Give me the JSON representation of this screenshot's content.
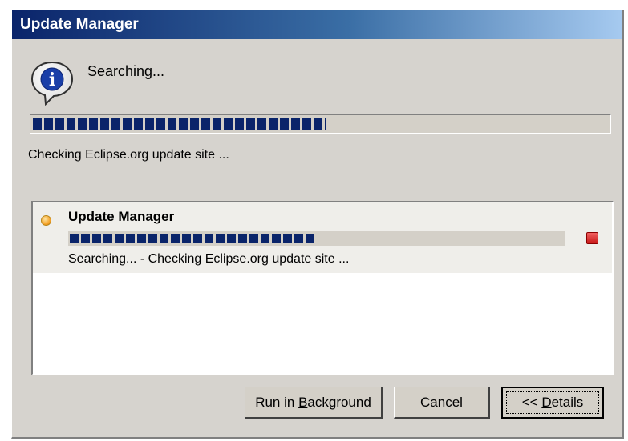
{
  "window": {
    "title": "Update Manager"
  },
  "status": {
    "message": "Searching...",
    "progress": 0.51,
    "detail": "Checking Eclipse.org update site ..."
  },
  "details": {
    "job": {
      "title": "Update Manager",
      "progress": 0.5,
      "detail": "Searching... - Checking Eclipse.org update site ..."
    }
  },
  "buttons": {
    "run_in_background": {
      "prefix": "Run in ",
      "accel": "B",
      "suffix": "ackground"
    },
    "cancel": "Cancel",
    "details": {
      "prefix": "<< ",
      "accel": "D",
      "suffix": "etails"
    }
  },
  "icons": {
    "info": "information-speech-bubble-icon",
    "job": "job-status-dot-icon",
    "stop": "stop-icon"
  },
  "colors": {
    "title_gradient_start": "#0a246a",
    "title_gradient_end": "#a6caf0",
    "progress_fill": "#0a246a",
    "dialog_background": "#d6d3ce",
    "stop_red": "#d42020"
  }
}
